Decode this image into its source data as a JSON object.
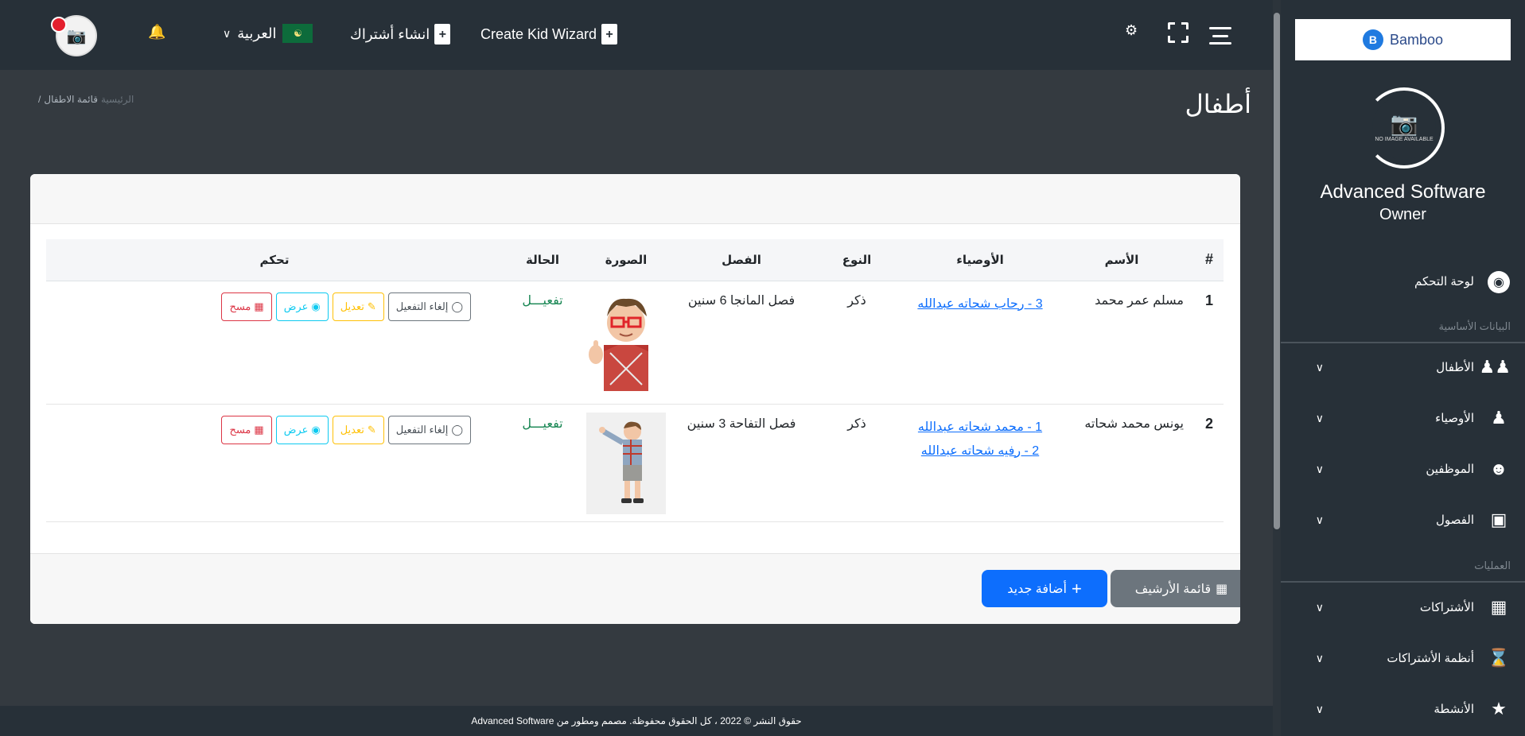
{
  "topbar": {
    "language_label": "العربية",
    "create_subscription_label": "انشاء أشتراك",
    "create_kid_wizard_label": "Create Kid Wizard",
    "icons": [
      "bell-icon",
      "chevron-down-icon",
      "flag-icon",
      "document-plus-icon",
      "gear-icon",
      "fullscreen-icon",
      "menu-icon"
    ]
  },
  "sidebar": {
    "brand": "Bamboo",
    "profile_noimage": "NO IMAGE AVAILABLE",
    "profile_name": "Advanced Software",
    "profile_role": "Owner",
    "dashboard_label": "لوحة التحكم",
    "section_basic": "البيانات الأساسية",
    "items_basic": [
      {
        "label": "الأطفال",
        "icon": "children-icon"
      },
      {
        "label": "الأوصياء",
        "icon": "person-icon"
      },
      {
        "label": "الموظفين",
        "icon": "employee-icon"
      },
      {
        "label": "الفصول",
        "icon": "classroom-icon"
      }
    ],
    "section_operations": "العمليات",
    "items_operations": [
      {
        "label": "الأشتراكات",
        "icon": "calendar-icon"
      },
      {
        "label": "أنظمة الأشتراكات",
        "icon": "hourglass-icon"
      },
      {
        "label": "الأنشطة",
        "icon": "activity-icon"
      }
    ]
  },
  "page": {
    "title": "أطفال",
    "breadcrumb_home": "الرئيسية",
    "breadcrumb_current": "قائمة الاطفال"
  },
  "table": {
    "headers": {
      "num": "#",
      "name": "الأسم",
      "guardians": "الأوصياء",
      "type": "النوع",
      "class": "الفصل",
      "photo": "الصورة",
      "status": "الحالة",
      "control": "تحكم"
    },
    "rows": [
      {
        "num": "1",
        "name": "مسلم عمر محمد",
        "guardians": [
          "3 - رحاب شحاته عبدالله"
        ],
        "type": "ذكر",
        "class": "فصل المانجا 6 سنين",
        "status": "تفعيـــل"
      },
      {
        "num": "2",
        "name": "يونس محمد شحاته",
        "guardians": [
          "1 - محمد شحاته عبدالله",
          "2 - رفيه شحاته عبدالله"
        ],
        "type": "ذكر",
        "class": "فصل التفاحة 3 سنين",
        "status": "تفعيـــل"
      }
    ],
    "actions": {
      "deactivate": "إلغاء التفعيل",
      "edit": "تعديل",
      "view": "عرض",
      "delete": "مسح"
    }
  },
  "buttons": {
    "archive": "قائمة الأرشيف",
    "add_new": "أضافة جديد"
  },
  "footer": {
    "text": "حقوق النشر © 2022 ، كل الحقوق محفوظة. مصمم ومطور من Advanced Software"
  },
  "colors": {
    "topbar": "#273038",
    "content_bg": "#343a40",
    "primary": "#0d6efd",
    "secondary": "#6c757d",
    "success": "#198754",
    "warning": "#ffc107",
    "info": "#0dcaf0",
    "danger": "#dc3545"
  }
}
